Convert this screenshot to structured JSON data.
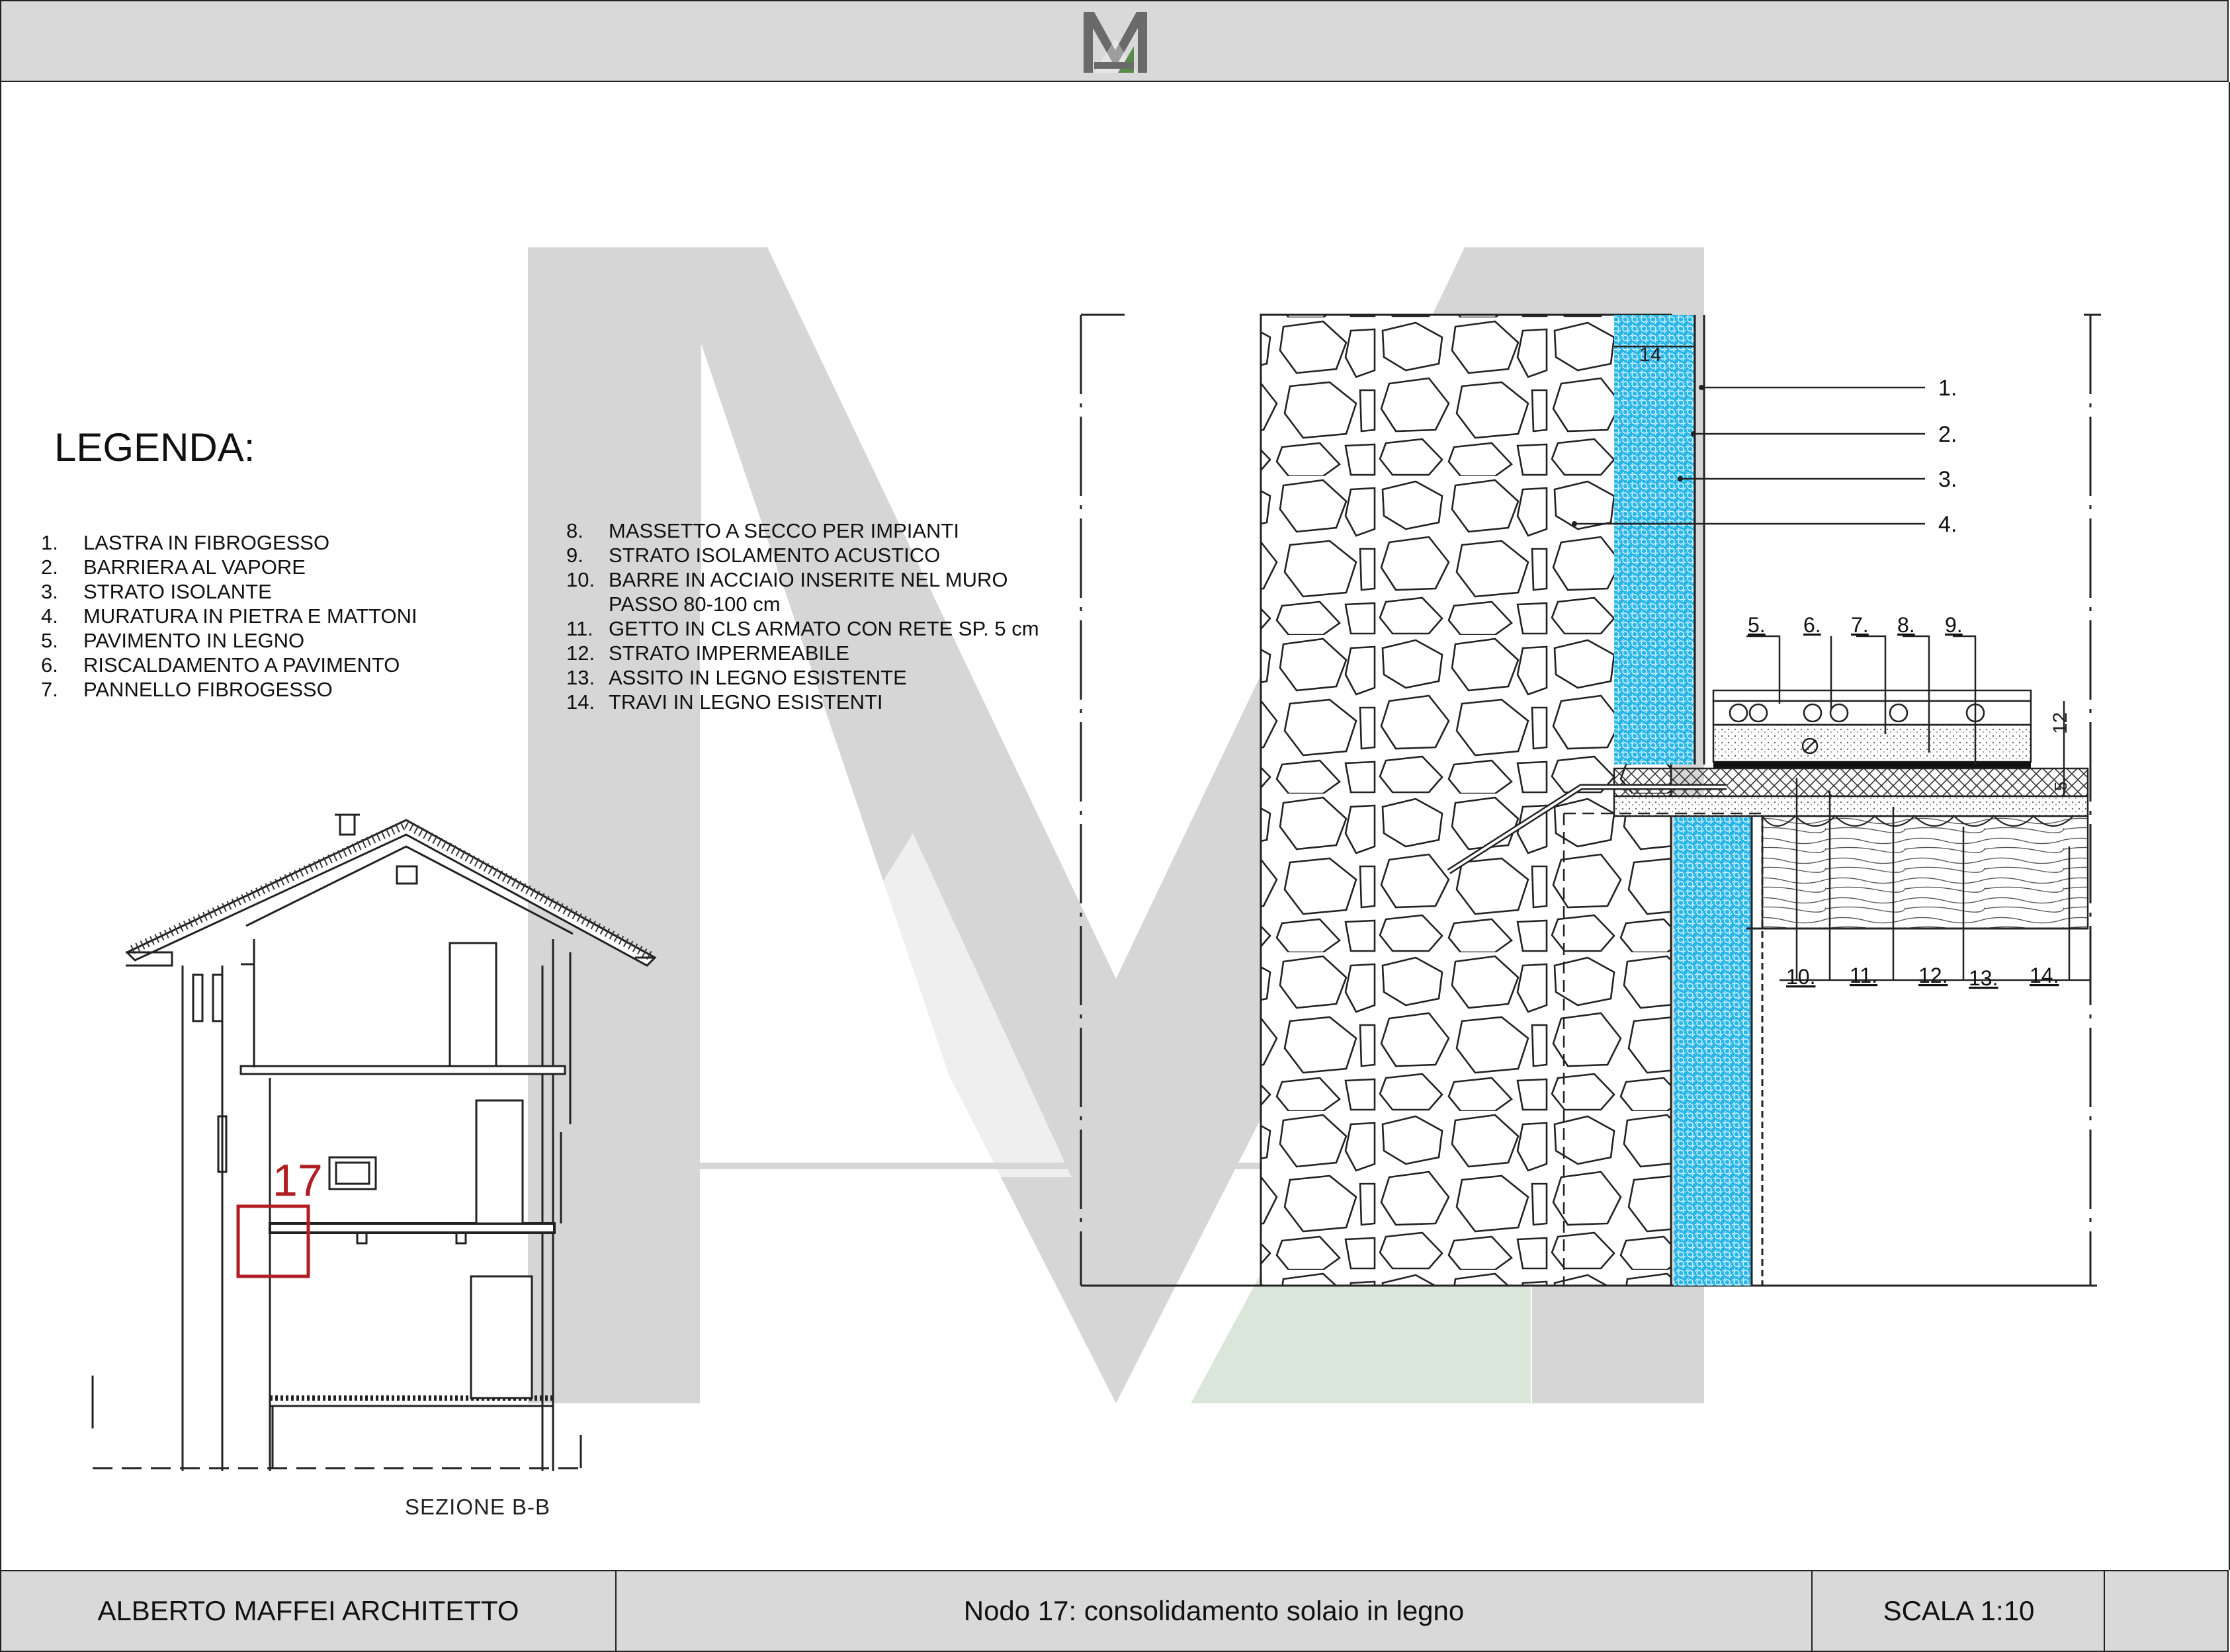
{
  "header": {
    "logo_icon": "am-monogram-logo-icon"
  },
  "legend": {
    "title": "LEGENDA:",
    "items_left": [
      {
        "num": "1.",
        "label": "LASTRA IN FIBROGESSO"
      },
      {
        "num": "2.",
        "label": "BARRIERA AL VAPORE"
      },
      {
        "num": "3.",
        "label": "STRATO ISOLANTE"
      },
      {
        "num": "4.",
        "label": "MURATURA IN PIETRA E MATTONI"
      },
      {
        "num": "5.",
        "label": "PAVIMENTO IN LEGNO"
      },
      {
        "num": "6.",
        "label": "RISCALDAMENTO A PAVIMENTO"
      },
      {
        "num": "7.",
        "label": "PANNELLO FIBROGESSO"
      }
    ],
    "items_right": [
      {
        "num": "8.",
        "label": "MASSETTO A SECCO PER IMPIANTI"
      },
      {
        "num": "9.",
        "label": "STRATO ISOLAMENTO ACUSTICO"
      },
      {
        "num": "10.",
        "label": "BARRE IN ACCIAIO INSERITE NEL MURO"
      },
      {
        "num": "",
        "label": "PASSO 80-100 cm"
      },
      {
        "num": "11.",
        "label": "GETTO IN CLS ARMATO CON RETE SP. 5 cm"
      },
      {
        "num": "12.",
        "label": "STRATO IMPERMEABILE"
      },
      {
        "num": "13.",
        "label": "ASSITO IN LEGNO ESISTENTE"
      },
      {
        "num": "14.",
        "label": "TRAVI IN LEGNO ESISTENTI"
      }
    ]
  },
  "section": {
    "caption": "SEZIONE B-B",
    "node_marker": "17",
    "marker_color": "#b01e23"
  },
  "detail": {
    "dimension_wall": "14",
    "dimension_floor": "12",
    "dimension_floor_small": "5",
    "callouts_right": [
      "1.",
      "2.",
      "3.",
      "4."
    ],
    "callouts_top": [
      "5.",
      "6.",
      "7.",
      "8.",
      "9."
    ],
    "callouts_bottom": [
      "10.",
      "11.",
      "12.",
      "13.",
      "14."
    ],
    "insulation_color": "#29b6e8"
  },
  "titleblock": {
    "author": "ALBERTO MAFFEI ARCHITETTO",
    "title": "Nodo 17: consolidamento solaio in legno",
    "scale": "SCALA 1:10"
  },
  "colors": {
    "band": "#d9d9d9",
    "watermark_grey": "#d6d6d6",
    "watermark_green": "#dbe6db",
    "logo_grey": "#6a6a6a",
    "logo_green": "#5a8a4a"
  }
}
